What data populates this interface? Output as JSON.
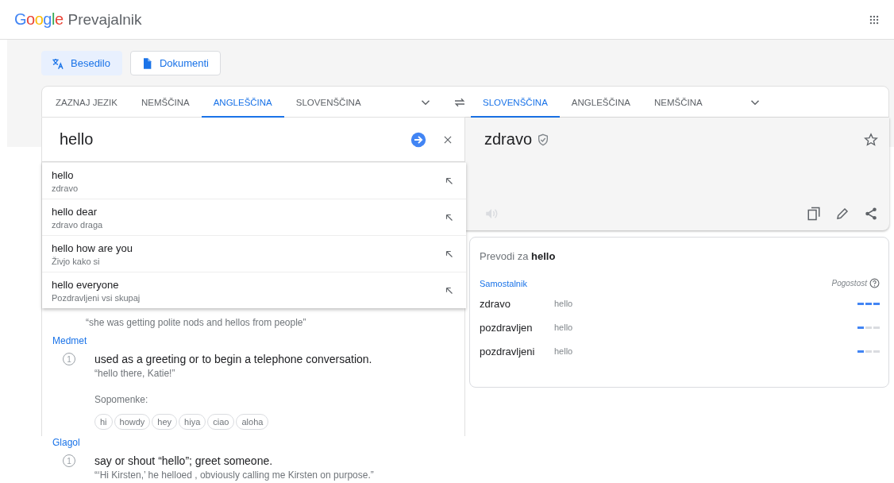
{
  "header": {
    "logo": "Google",
    "product": "Prevajalnik"
  },
  "modes": [
    {
      "label": "Besedilo",
      "kind": "text",
      "selected": true
    },
    {
      "label": "Dokumenti",
      "kind": "documents",
      "selected": false
    }
  ],
  "source_tabs": [
    {
      "label": "ZAZNAJ JEZIK",
      "selected": false
    },
    {
      "label": "NEMŠČINA",
      "selected": false
    },
    {
      "label": "ANGLEŠČINA",
      "selected": true
    },
    {
      "label": "SLOVENŠČINA",
      "selected": false
    }
  ],
  "target_tabs": [
    {
      "label": "SLOVENŠČINA",
      "selected": true
    },
    {
      "label": "ANGLEŠČINA",
      "selected": false
    },
    {
      "label": "NEMŠČINA",
      "selected": false
    }
  ],
  "input": {
    "value": "hello"
  },
  "suggestions": [
    {
      "text": "hello",
      "translation": "zdravo"
    },
    {
      "text": "hello dear",
      "translation": "zdravo draga"
    },
    {
      "text": "hello how are you",
      "translation": "Živjo kako si"
    },
    {
      "text": "hello everyone",
      "translation": "Pozdravljeni vsi skupaj"
    }
  ],
  "output": {
    "value": "zdravo"
  },
  "dictionary": {
    "example": "“she was getting polite nods and hellos from people”",
    "sections": [
      {
        "part_of_speech": "Medmet",
        "senses": [
          {
            "number": "1",
            "definition": "used as a greeting or to begin a telephone conversation.",
            "example": "“hello there, Katie!”",
            "synonyms_label": "Sopomenke:",
            "synonyms": [
              "hi",
              "howdy",
              "hey",
              "hiya",
              "ciao",
              "aloha"
            ]
          }
        ]
      },
      {
        "part_of_speech": "Glagol",
        "senses": [
          {
            "number": "1",
            "definition": "say or shout “hello”; greet someone.",
            "example": "“‘Hi Kirsten,’ he helloed , obviously calling me Kirsten on purpose.”"
          }
        ]
      }
    ]
  },
  "translations": {
    "title": "Prevodi za **hello**",
    "part_of_speech": "Samostalnik",
    "frequency_label": "Pogostost",
    "rows": [
      {
        "word": "zdravo",
        "back": "hello",
        "level": 1
      },
      {
        "word": "pozdravljen",
        "back": "hello",
        "level": 0.33
      },
      {
        "word": "pozdravljeni",
        "back": "hello",
        "level": 0.33
      }
    ]
  }
}
